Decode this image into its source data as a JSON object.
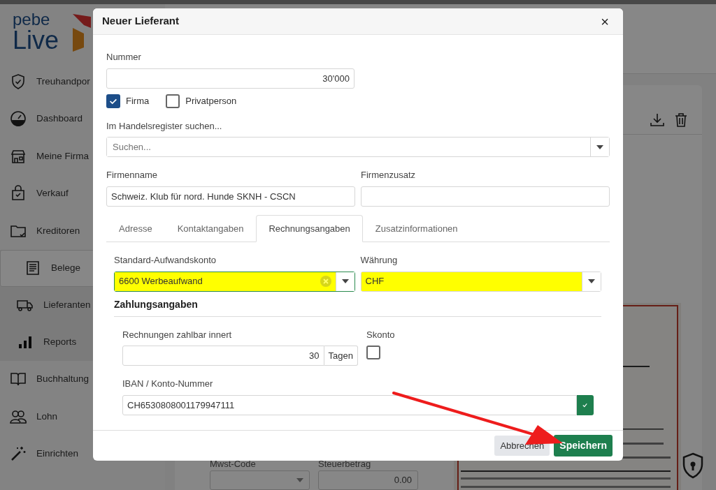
{
  "logo": {
    "line1": "pebe",
    "line2": "Live"
  },
  "sidebar": {
    "items": [
      {
        "label": "Treuhandpor",
        "selected": false
      },
      {
        "label": "Dashboard",
        "selected": false
      },
      {
        "label": "Meine Firma",
        "selected": false
      },
      {
        "label": "Verkauf",
        "selected": false
      },
      {
        "label": "Kreditoren",
        "selected": false,
        "children": [
          {
            "label": "Belege",
            "selected": true
          },
          {
            "label": "Lieferanten",
            "selected": false
          },
          {
            "label": "Reports",
            "selected": false
          }
        ]
      },
      {
        "label": "Buchhaltung",
        "selected": false
      },
      {
        "label": "Lohn",
        "selected": false
      },
      {
        "label": "Einrichten",
        "selected": false
      }
    ]
  },
  "background_fields": [
    {
      "label": "Mwst-Code",
      "kind": "select"
    },
    {
      "label": "Steuerbetrag",
      "kind": "input",
      "value": "0.00"
    }
  ],
  "dialog": {
    "title": "Neuer Lieferant",
    "close": "×",
    "nummer": {
      "label": "Nummer",
      "value": "30'000"
    },
    "type_options": [
      {
        "label": "Firma",
        "checked": true
      },
      {
        "label": "Privatperson",
        "checked": false
      }
    ],
    "register_search": {
      "label": "Im Handelsregister suchen...",
      "placeholder": "Suchen..."
    },
    "company_fields": [
      {
        "label": "Firmenname",
        "value": "Schweiz. Klub für nord. Hunde SKNH - CSCN"
      },
      {
        "label": "Firmenzusatz"
      }
    ],
    "tabs": [
      {
        "label": "Adresse",
        "selected": false
      },
      {
        "label": "Kontaktangaben",
        "selected": false
      },
      {
        "label": "Rechnungsangaben",
        "selected": true
      },
      {
        "label": "Zusatzinformationen",
        "selected": false
      }
    ],
    "account_fields": [
      {
        "label": "Standard-Aufwandskonto",
        "value": "6600 Werbeaufwand",
        "highlighted": true,
        "clearable": true
      },
      {
        "label": "Währung",
        "value": "CHF",
        "highlighted": true,
        "clearable": false
      }
    ],
    "payment": {
      "heading": "Zahlungsangaben",
      "due": {
        "label": "Rechnungen zahlbar innert",
        "value": "30",
        "unit": "Tagen"
      },
      "skonto": {
        "label": "Skonto",
        "checked": false
      },
      "iban": {
        "label": "IBAN / Konto-Nummer",
        "value": "CH6530808001179947111",
        "valid": true
      }
    },
    "buttons": [
      {
        "label": "Abbrechen",
        "kind": "secondary"
      },
      {
        "label": "Speichern",
        "kind": "primary"
      }
    ]
  }
}
